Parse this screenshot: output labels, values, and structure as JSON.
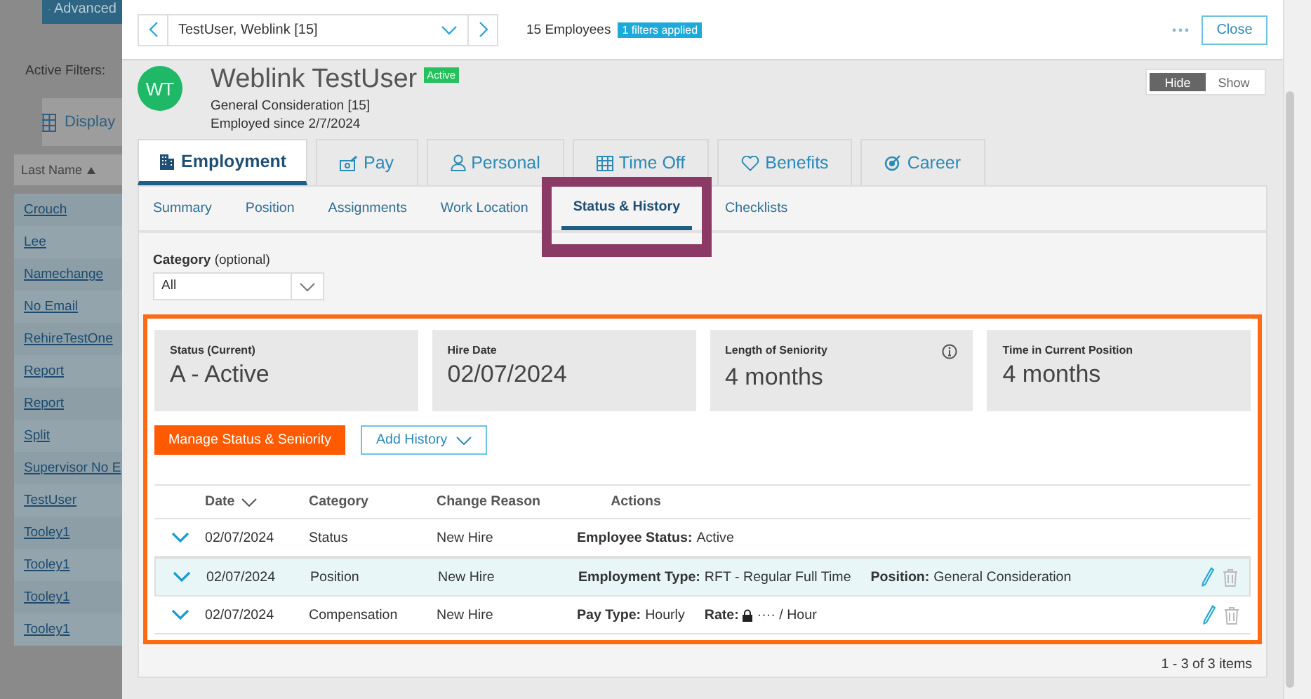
{
  "left_panel": {
    "advanced_button": "Advanced",
    "active_filters_label": "Active Filters:",
    "display_button": "Display",
    "column_header": "Last Name",
    "names": [
      "Crouch",
      "Lee",
      "Namechange",
      "No Email",
      "RehireTestOne",
      "Report",
      "Report",
      "Split",
      "Supervisor No E",
      "TestUser",
      "Tooley1",
      "Tooley1",
      "Tooley1",
      "Tooley1"
    ]
  },
  "header": {
    "employee_select": "TestUser, Weblink [15]",
    "employee_count": "15 Employees",
    "filter_badge": "1 filters applied",
    "close_button": "Close"
  },
  "profile": {
    "initials": "WT",
    "name": "Weblink TestUser",
    "status_badge": "Active",
    "position": "General Consideration [15]",
    "employed_since": "Employed since 2/7/2024",
    "toggle": [
      {
        "label": "Hide",
        "selected": true
      },
      {
        "label": "Show",
        "selected": false
      }
    ]
  },
  "tabs": [
    {
      "label": "Employment",
      "selected": true
    },
    {
      "label": "Pay",
      "selected": false
    },
    {
      "label": "Personal",
      "selected": false
    },
    {
      "label": "Time Off",
      "selected": false
    },
    {
      "label": "Benefits",
      "selected": false
    },
    {
      "label": "Career",
      "selected": false
    }
  ],
  "subtabs": [
    {
      "label": "Summary",
      "selected": false
    },
    {
      "label": "Position",
      "selected": false
    },
    {
      "label": "Assignments",
      "selected": false
    },
    {
      "label": "Work Location",
      "selected": false
    },
    {
      "label": "Status & History",
      "selected": true
    },
    {
      "label": "Checklists",
      "selected": false
    }
  ],
  "category_filter": {
    "label": "Category",
    "hint": "(optional)",
    "value": "All"
  },
  "summary_cards": [
    {
      "label": "Status (Current)",
      "value": "A - Active",
      "info": false
    },
    {
      "label": "Hire Date",
      "value": "02/07/2024",
      "info": false
    },
    {
      "label": "Length of Seniority",
      "value": "4 months",
      "info": true
    },
    {
      "label": "Time in Current Position",
      "value": "4 months",
      "info": false
    }
  ],
  "buttons": {
    "primary": "Manage Status & Seniority",
    "secondary": "Add History"
  },
  "table": {
    "columns": [
      {
        "label": "Date",
        "sorted": true
      },
      {
        "label": "Category",
        "sorted": false
      },
      {
        "label": "Change Reason",
        "sorted": false
      },
      {
        "label": "Actions",
        "sorted": false
      }
    ],
    "rows": [
      {
        "expanded": false,
        "selected": false,
        "date": "02/07/2024",
        "category": "Status",
        "reason": "New Hire",
        "details": [
          {
            "label": "Employee Status:",
            "value": "Active",
            "masked": false
          }
        ],
        "actions": false
      },
      {
        "expanded": false,
        "selected": true,
        "date": "02/07/2024",
        "category": "Position",
        "reason": "New Hire",
        "details": [
          {
            "label": "Employment Type:",
            "value": "RFT - Regular Full Time",
            "masked": false
          },
          {
            "label": "Position:",
            "value": "General Consideration",
            "masked": false
          }
        ],
        "actions": true
      },
      {
        "expanded": false,
        "selected": false,
        "date": "02/07/2024",
        "category": "Compensation",
        "reason": "New Hire",
        "details": [
          {
            "label": "Pay Type:",
            "value": "Hourly",
            "masked": false
          },
          {
            "label": "Rate:",
            "value": "···· / Hour",
            "masked": true
          }
        ],
        "actions": true
      }
    ]
  },
  "pager": "1 - 3 of 3 items"
}
